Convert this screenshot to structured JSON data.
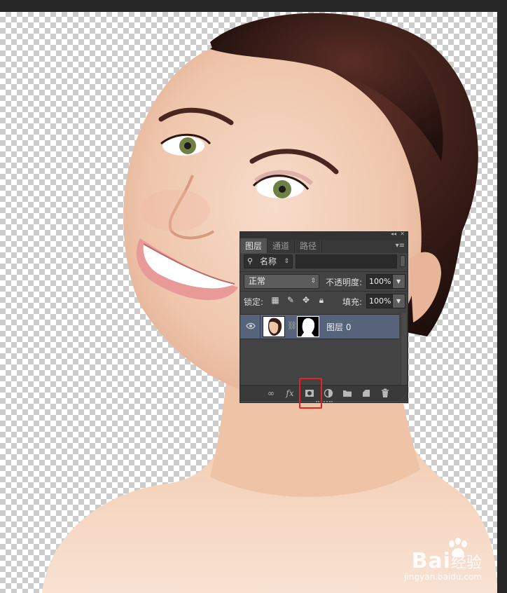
{
  "panel": {
    "tabs": [
      {
        "label": "图层",
        "active": true
      },
      {
        "label": "通道",
        "active": false
      },
      {
        "label": "路径",
        "active": false
      }
    ],
    "filter": {
      "kind_label": "名称",
      "search_value": ""
    },
    "blend_mode": "正常",
    "opacity_label": "不透明度:",
    "opacity_value": "100%",
    "lock_label": "锁定:",
    "lock_icons": [
      "lock-transparent-pixels-icon",
      "lock-image-pixels-icon",
      "lock-position-icon",
      "lock-all-icon"
    ],
    "fill_label": "填充:",
    "fill_value": "100%",
    "layers": [
      {
        "name": "图层 0",
        "visible": true,
        "selected": true,
        "has_mask": true
      }
    ],
    "bottom_tools": [
      "link-layers-icon",
      "fx-icon",
      "add-mask-icon",
      "adjustment-layer-icon",
      "folder-icon",
      "new-layer-icon",
      "trash-icon"
    ],
    "highlighted_tool": "add-mask-icon"
  },
  "watermark": {
    "brand": "Bai",
    "brand_suffix": "经验",
    "url": "jingyan.baidu.com"
  },
  "colors": {
    "selection_row": "#56637a",
    "highlight": "#e8231e",
    "panel_bg": "#434343"
  }
}
